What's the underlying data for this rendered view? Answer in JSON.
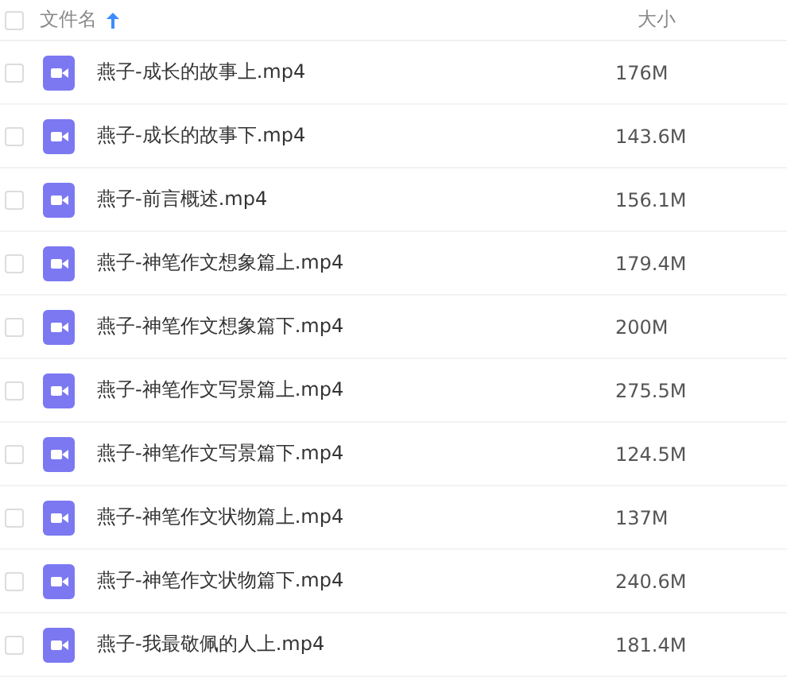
{
  "header": {
    "checked": false,
    "name_label": "文件名",
    "size_label": "大小",
    "sort_ascending": true
  },
  "files": [
    {
      "name": "燕子-成长的故事上.mp4",
      "size": "176M",
      "checked": false
    },
    {
      "name": "燕子-成长的故事下.mp4",
      "size": "143.6M",
      "checked": false
    },
    {
      "name": "燕子-前言概述.mp4",
      "size": "156.1M",
      "checked": false
    },
    {
      "name": "燕子-神笔作文想象篇上.mp4",
      "size": "179.4M",
      "checked": false
    },
    {
      "name": "燕子-神笔作文想象篇下.mp4",
      "size": "200M",
      "checked": false
    },
    {
      "name": "燕子-神笔作文写景篇上.mp4",
      "size": "275.5M",
      "checked": false
    },
    {
      "name": "燕子-神笔作文写景篇下.mp4",
      "size": "124.5M",
      "checked": false
    },
    {
      "name": "燕子-神笔作文状物篇上.mp4",
      "size": "137M",
      "checked": false
    },
    {
      "name": "燕子-神笔作文状物篇下.mp4",
      "size": "240.6M",
      "checked": false
    },
    {
      "name": "燕子-我最敬佩的人上.mp4",
      "size": "181.4M",
      "checked": false
    }
  ]
}
